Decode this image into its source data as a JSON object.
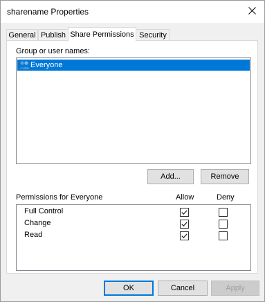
{
  "window": {
    "title": "sharename Properties"
  },
  "tabs": [
    {
      "label": "General"
    },
    {
      "label": "Publish"
    },
    {
      "label": "Share Permissions"
    },
    {
      "label": "Security"
    }
  ],
  "active_tab": "Share Permissions",
  "users": {
    "label": "Group or user names:",
    "items": [
      {
        "name": "Everyone",
        "icon": "users-group-icon",
        "selected": true
      }
    ]
  },
  "user_buttons": {
    "add": "Add...",
    "remove": "Remove"
  },
  "permissions": {
    "label": "Permissions for Everyone",
    "allow_header": "Allow",
    "deny_header": "Deny",
    "rows": [
      {
        "name": "Full Control",
        "allow": true,
        "deny": false
      },
      {
        "name": "Change",
        "allow": true,
        "deny": false
      },
      {
        "name": "Read",
        "allow": true,
        "deny": false
      }
    ]
  },
  "footer": {
    "ok": "OK",
    "cancel": "Cancel",
    "apply": "Apply",
    "apply_disabled": true
  },
  "colors": {
    "selection": "#0078d7",
    "default_button_border": "#0078d7"
  }
}
